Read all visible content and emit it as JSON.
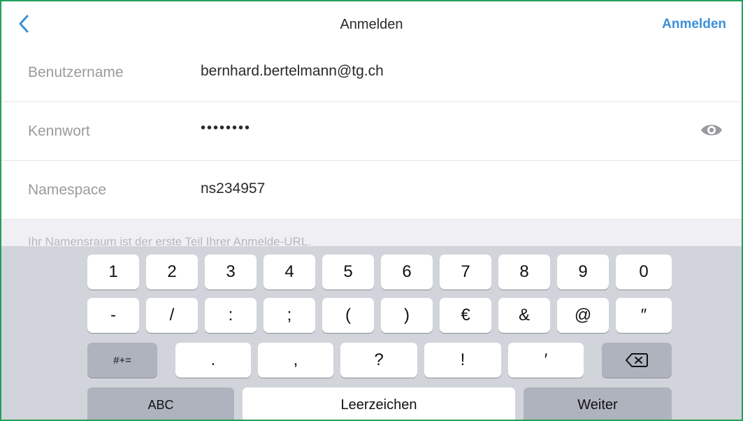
{
  "nav": {
    "title": "Anmelden",
    "action_label": "Anmelden",
    "back_icon": "chevron-left-icon",
    "accent_color": "#3b8fd9"
  },
  "form": {
    "username": {
      "label": "Benutzername",
      "value": "bernhard.bertelmann@tg.ch"
    },
    "password": {
      "label": "Kennwort",
      "value": "••••••••",
      "toggle_icon": "eye-icon"
    },
    "namespace": {
      "label": "Namespace",
      "value": "ns234957"
    }
  },
  "hint": "Ihr Namensraum ist der erste Teil Ihrer Anmelde-URL.",
  "keyboard": {
    "row1": [
      "1",
      "2",
      "3",
      "4",
      "5",
      "6",
      "7",
      "8",
      "9",
      "0"
    ],
    "row2": [
      "-",
      "/",
      ":",
      ";",
      "(",
      ")",
      "€",
      "&",
      "@",
      "″"
    ],
    "row3": {
      "symbols_label": "#+=",
      "keys": [
        ".",
        ",",
        "?",
        "!",
        "′"
      ],
      "delete_icon": "backspace-icon"
    },
    "row4": {
      "abc_label": "ABC",
      "space_label": "Leerzeichen",
      "return_label": "Weiter"
    }
  },
  "colors": {
    "frame_border": "#22a05a",
    "keyboard_bg": "#d1d4da"
  }
}
